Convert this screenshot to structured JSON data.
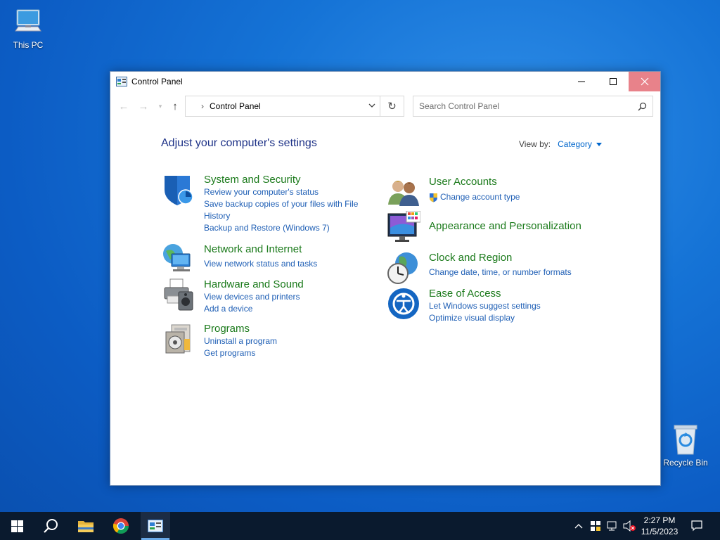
{
  "desktop": {
    "this_pc": "This PC",
    "recycle_bin": "Recycle Bin"
  },
  "window": {
    "title": "Control Panel",
    "address": "Control Panel",
    "search_placeholder": "Search Control Panel"
  },
  "content": {
    "heading": "Adjust your computer's settings",
    "view_by_label": "View by:",
    "view_by_value": "Category"
  },
  "categories": {
    "system_security": {
      "title": "System and Security",
      "links": [
        "Review your computer's status",
        "Save backup copies of your files with File",
        "History",
        "Backup and Restore (Windows 7)"
      ]
    },
    "network": {
      "title": "Network and Internet",
      "links": [
        "View network status and tasks"
      ]
    },
    "hardware": {
      "title": "Hardware and Sound",
      "links": [
        "View devices and printers",
        "Add a device"
      ]
    },
    "programs": {
      "title": "Programs",
      "links": [
        "Uninstall a program",
        "Get programs"
      ]
    },
    "user_accounts": {
      "title": "User Accounts",
      "links": [
        "Change account type"
      ]
    },
    "appearance": {
      "title": "Appearance and Personalization",
      "links": []
    },
    "clock": {
      "title": "Clock and Region",
      "links": [
        "Change date, time, or number formats"
      ]
    },
    "ease": {
      "title": "Ease of Access",
      "links": [
        "Let Windows suggest settings",
        "Optimize visual display"
      ]
    }
  },
  "taskbar": {
    "time": "2:27 PM",
    "date": "11/5/2023"
  },
  "colors": {
    "category_title": "#1b7a1b",
    "link": "#1f5fb5",
    "heading": "#1e3287",
    "close_hover": "#e8828a"
  }
}
